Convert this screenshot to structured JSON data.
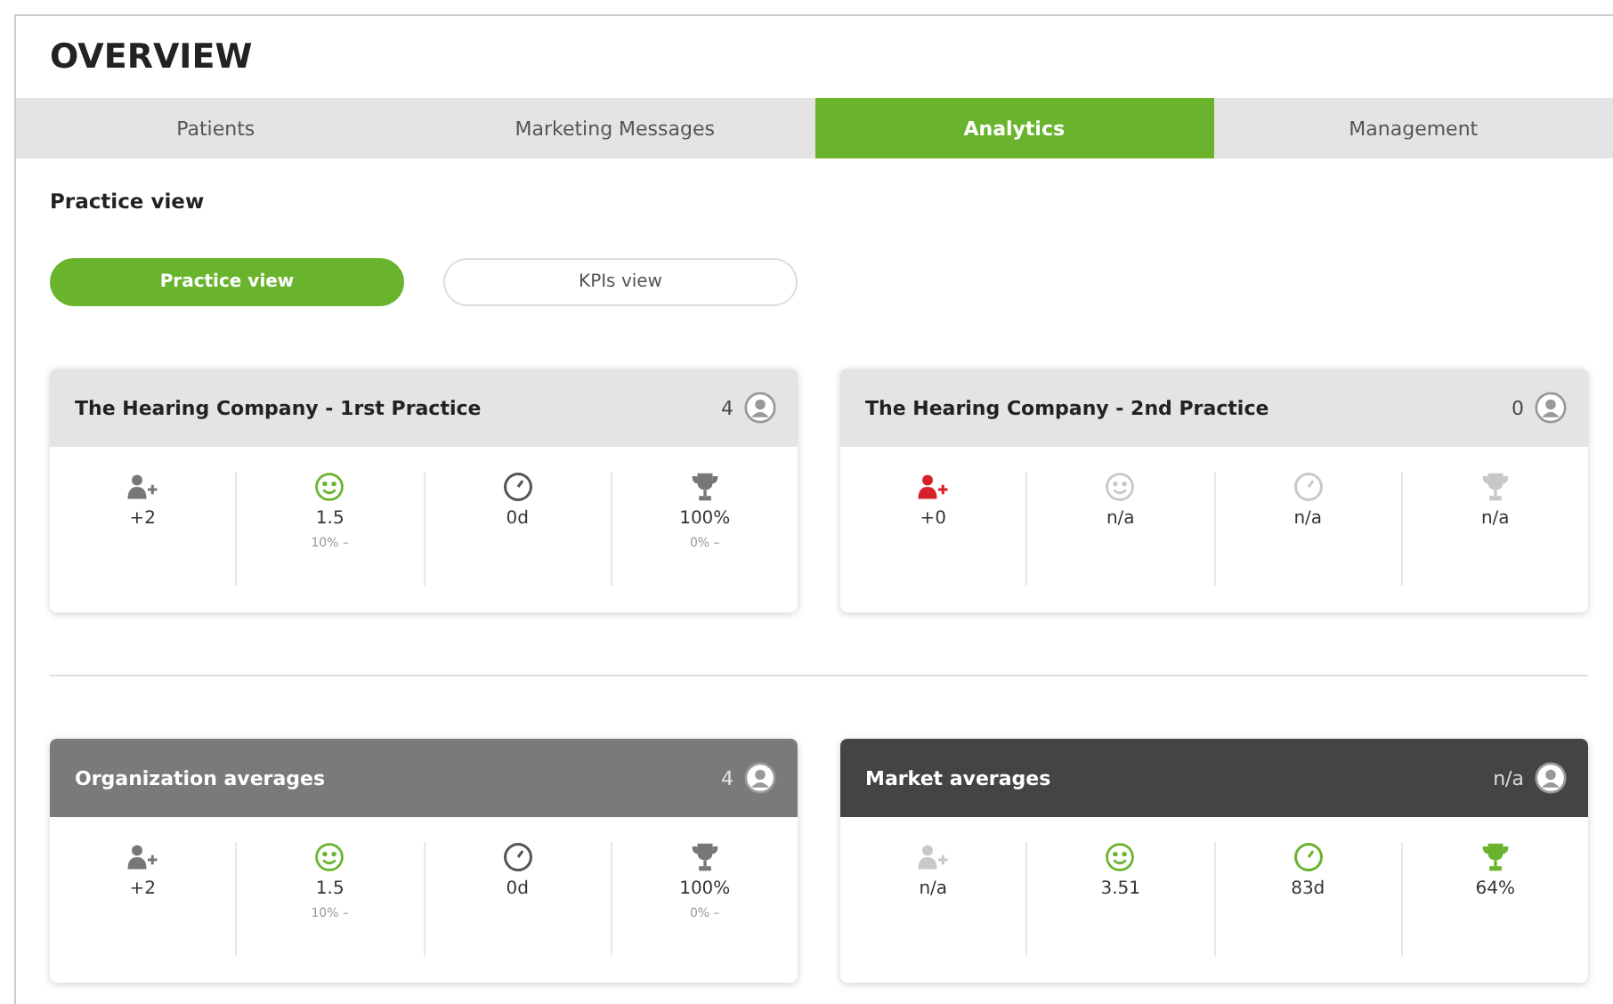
{
  "title": "OVERVIEW",
  "tabs": [
    {
      "label": "Patients",
      "selected": false
    },
    {
      "label": "Marketing Messages",
      "selected": false
    },
    {
      "label": "Analytics",
      "selected": true
    },
    {
      "label": "Management",
      "selected": false
    }
  ],
  "section_label": "Practice view",
  "view_toggle": [
    {
      "label": "Practice view",
      "selected": true
    },
    {
      "label": "KPIs view",
      "selected": false
    }
  ],
  "card_rows": [
    [
      {
        "title": "The Hearing Company - 1rst Practice",
        "kind": "light",
        "count": "4",
        "metrics": [
          {
            "kind": "user-add",
            "color": "#777777",
            "value": "+2"
          },
          {
            "kind": "smiley",
            "color": "#6ab42d",
            "value": "1.5",
            "sub": "10% –"
          },
          {
            "kind": "clock",
            "color": "#555555",
            "value": "0d"
          },
          {
            "kind": "trophy",
            "color": "#777777",
            "value": "100%",
            "sub": "0% –"
          }
        ]
      },
      {
        "title": "The Hearing Company - 2nd Practice",
        "kind": "light",
        "count": "0",
        "metrics": [
          {
            "kind": "user-add",
            "color": "#d8202a",
            "value": "+0"
          },
          {
            "kind": "smiley",
            "color": "#c8c8c8",
            "value": "n/a"
          },
          {
            "kind": "clock",
            "color": "#c8c8c8",
            "value": "n/a"
          },
          {
            "kind": "trophy",
            "color": "#c8c8c8",
            "value": "n/a"
          }
        ]
      }
    ],
    [
      {
        "title": "Organization averages",
        "kind": "mid",
        "count": "4",
        "metrics": [
          {
            "kind": "user-add",
            "color": "#777777",
            "value": "+2"
          },
          {
            "kind": "smiley",
            "color": "#6ab42d",
            "value": "1.5",
            "sub": "10% –"
          },
          {
            "kind": "clock",
            "color": "#555555",
            "value": "0d"
          },
          {
            "kind": "trophy",
            "color": "#777777",
            "value": "100%",
            "sub": "0% –"
          }
        ]
      },
      {
        "title": "Market averages",
        "kind": "dark",
        "count": "n/a",
        "metrics": [
          {
            "kind": "user-add",
            "color": "#c8c8c8",
            "value": "n/a"
          },
          {
            "kind": "smiley",
            "color": "#6ab42d",
            "value": "3.51"
          },
          {
            "kind": "clock",
            "color": "#6ab42d",
            "value": "83d"
          },
          {
            "kind": "trophy",
            "color": "#6ab42d",
            "value": "64%"
          }
        ]
      }
    ]
  ]
}
